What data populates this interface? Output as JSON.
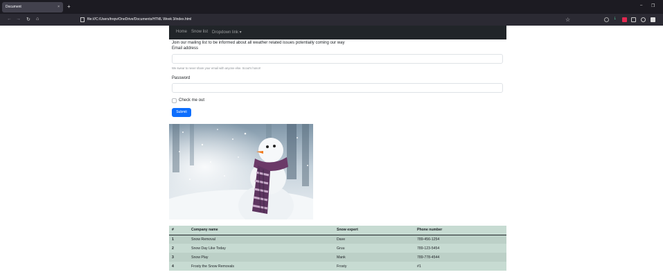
{
  "browser": {
    "tab_title": "Document",
    "tab_close": "×",
    "new_tab": "+",
    "url": "file:///C:/Users/trepv/OneDrive/Documents/HTML Week 3/index.html",
    "minimize": "–",
    "restore": "❐"
  },
  "nav": {
    "home": "Home",
    "snow_list": "Snow list",
    "dropdown": "Dropdown link ▾"
  },
  "form": {
    "intro": "Join our mailing list to be informed about all weather related issues potentially coming our way",
    "email_label": "Email address",
    "email_help": "We swear to never share your email with anyone else. Scout's honor!",
    "password_label": "Password",
    "check_label": "Check me out",
    "submit_label": "Submit"
  },
  "table": {
    "headers": [
      "#",
      "Company name",
      "Snow expert",
      "Phone number"
    ],
    "rows": [
      [
        "1",
        "Snow Removal",
        "Dave",
        "789-456-1254"
      ],
      [
        "2",
        "Snow Day Like Today",
        "Gruu",
        "789-123-5454"
      ],
      [
        "3",
        "Snow Play",
        "Mank",
        "789-778-4544"
      ],
      [
        "4",
        "Frosty the Snow Removals",
        "Frosty",
        "#1"
      ]
    ]
  },
  "colors": {
    "navbar_bg": "#212529",
    "submit_bg": "#0d6efd",
    "table_row_a": "#c7dbd2",
    "table_row_b": "#bcd0c7"
  }
}
